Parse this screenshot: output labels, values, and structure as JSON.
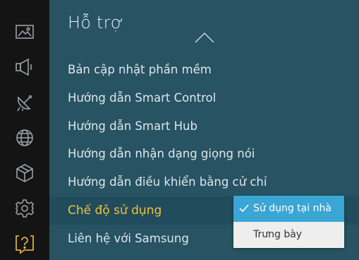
{
  "sidebar": {
    "icons": [
      "picture-icon",
      "sound-icon",
      "broadcast-icon",
      "network-icon",
      "system-icon",
      "settings-icon",
      "support-icon"
    ],
    "active_color": "#f2c040"
  },
  "support": {
    "title": "Hỗ trợ",
    "items": [
      {
        "label": "Bản cập nhật phần mềm"
      },
      {
        "label": "Hướng dẫn Smart Control"
      },
      {
        "label": "Hướng dẫn Smart Hub"
      },
      {
        "label": "Hướng dẫn nhận dạng giọng nói"
      },
      {
        "label": "Hướng dẫn điều khiển bằng cử chỉ"
      },
      {
        "label": "Chế độ sử dụng"
      },
      {
        "label": "Liên hệ với Samsung"
      }
    ]
  },
  "usage_mode_popup": {
    "options": [
      {
        "label": "Sử dụng tại nhà",
        "selected": true
      },
      {
        "label": "Trưng bày",
        "selected": false
      }
    ],
    "highlight_color": "#39a6d3"
  }
}
